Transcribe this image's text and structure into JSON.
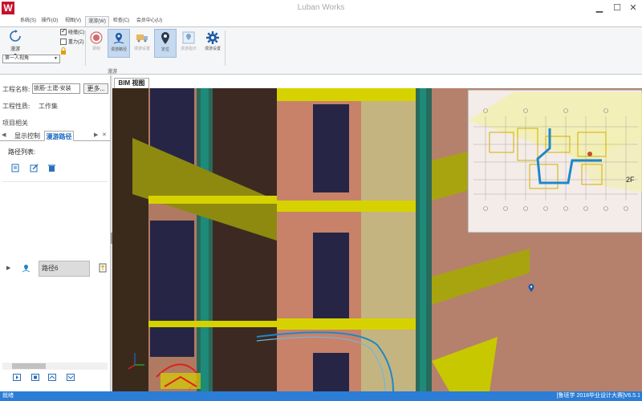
{
  "app": {
    "title": "Luban Works",
    "logo_letter": "W",
    "brand_color": "#c8102e"
  },
  "menu": {
    "tabs": [
      {
        "label": "系统(S)"
      },
      {
        "label": "操作(O)"
      },
      {
        "label": "视图(V)"
      },
      {
        "label": "漫游(W)",
        "active": true
      },
      {
        "label": "检查(C)"
      },
      {
        "label": "会员中心(U)"
      }
    ]
  },
  "ribbon": {
    "group_label": "漫游",
    "roam_button": {
      "label": "漫游",
      "icon": "roam-icon"
    },
    "view_mode": {
      "selected": "第一人视角"
    },
    "checkboxes": [
      {
        "label": "碰撞(C)",
        "checked": true
      },
      {
        "label": "重力(Z)",
        "checked": false
      }
    ],
    "buttons": [
      {
        "label": "录制",
        "icon": "record-icon",
        "disabled": true
      },
      {
        "label": "漫游路径",
        "icon": "path-pin-icon",
        "active": true
      },
      {
        "label": "漫游设置",
        "icon": "truck-icon",
        "disabled": true
      },
      {
        "label": "定位",
        "icon": "location-icon",
        "active": true
      },
      {
        "label": "漫游指示",
        "icon": "map-pin-icon",
        "disabled": true
      },
      {
        "label": "漫游设置",
        "icon": "gear-icon"
      }
    ]
  },
  "left_panel": {
    "project_name_label": "工程名称:",
    "project_name_value": "锁筋-土建-安装",
    "more_button": "更多...",
    "project_type_label": "工程性质:",
    "project_type_value": "工作集",
    "project_related": "项目相关",
    "tabs": [
      {
        "label": "显示控制"
      },
      {
        "label": "漫游路径",
        "active": true
      }
    ],
    "path_list_title": "路径列表:",
    "paths": [
      {
        "name": "路径6"
      }
    ]
  },
  "viewport": {
    "tab_label": "BIM 视图",
    "minimap_floor": "2F"
  },
  "status": {
    "text": "就绪",
    "right_text": "[鲁班学 2018毕业设计大赛]",
    "version": "V6.5.1"
  },
  "colors": {
    "ribbon_bg": "#f5f6f7",
    "active_button": "#c5d9ef",
    "status_bar": "#2b7dd5",
    "wall": "#b5816c",
    "duct": "#c8c800",
    "path_line": "#1e88c8"
  }
}
